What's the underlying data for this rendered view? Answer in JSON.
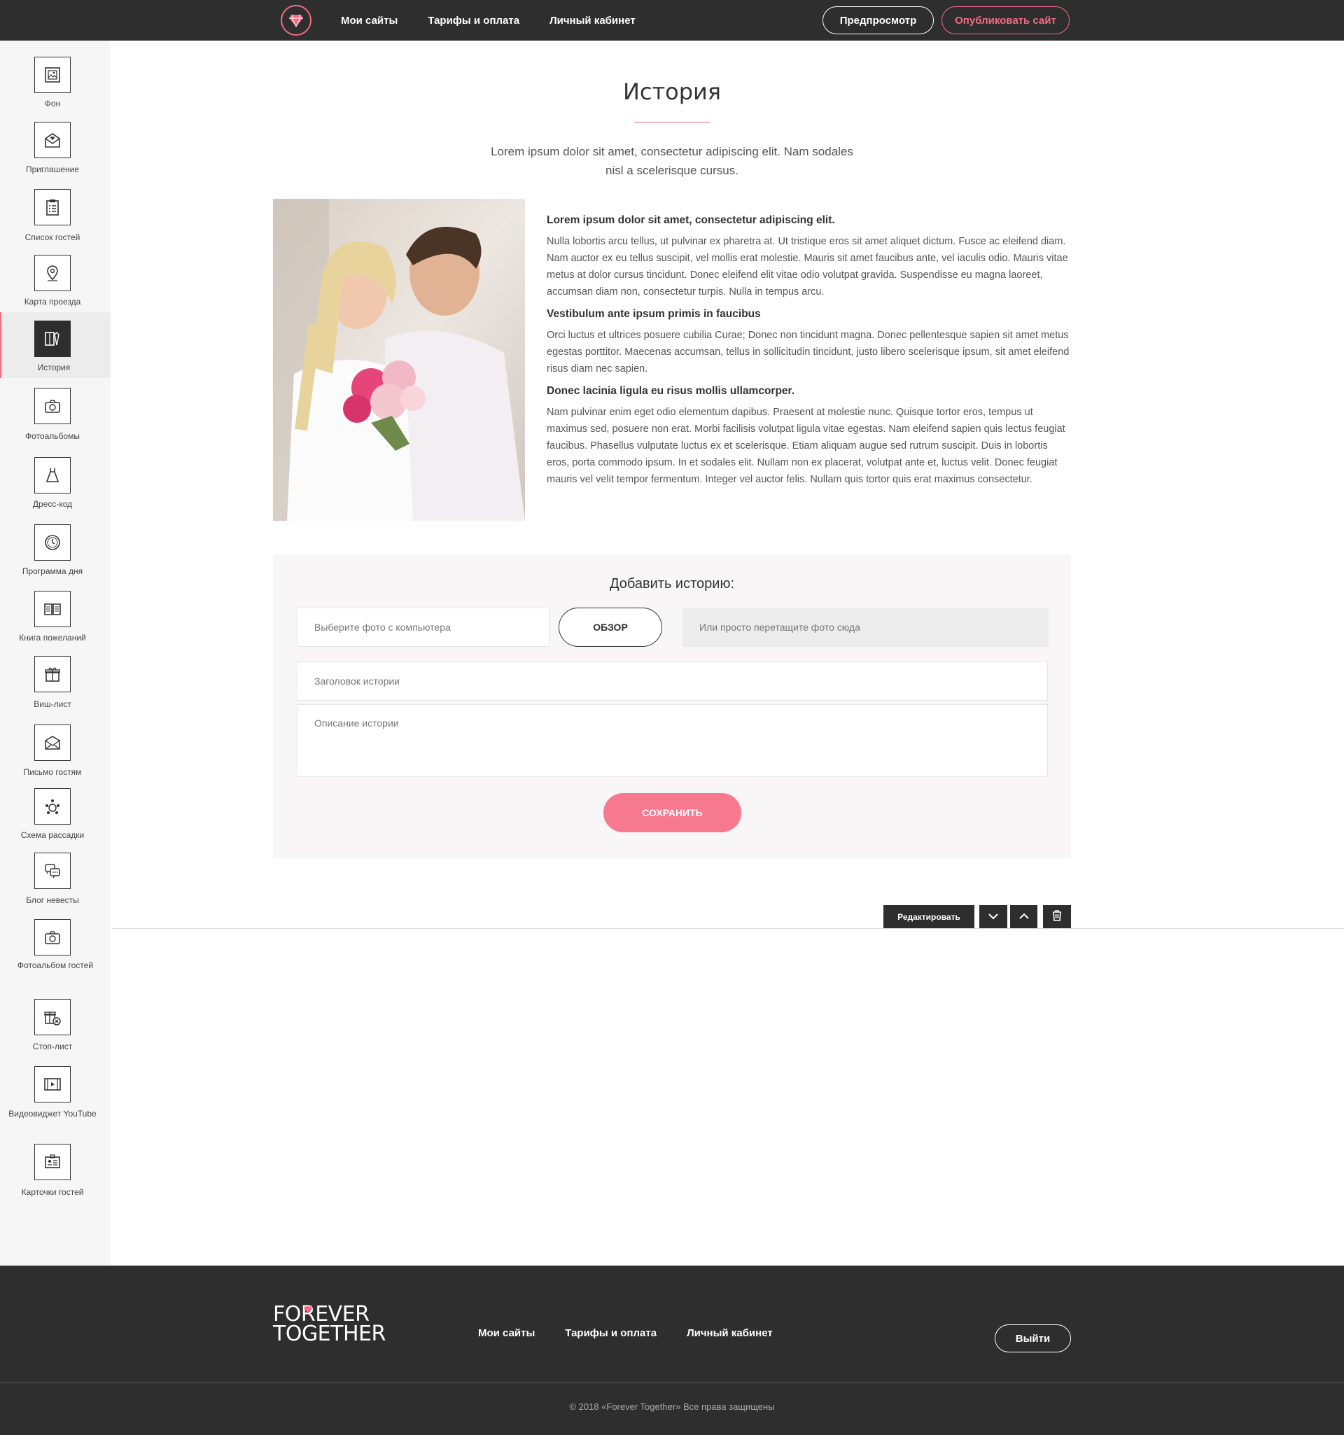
{
  "header": {
    "nav": [
      "Мои сайты",
      "Тарифы и оплата",
      "Личный кабинет"
    ],
    "preview_label": "Предпросмотр",
    "publish_label": "Опубликовать сайт"
  },
  "sidebar": {
    "items": [
      {
        "label": "Фон",
        "icon": "image-icon"
      },
      {
        "label": "Приглашение",
        "icon": "envelope-icon"
      },
      {
        "label": "Список гостей",
        "icon": "clipboard-list-icon"
      },
      {
        "label": "Карта проезда",
        "icon": "map-pin-icon"
      },
      {
        "label": "История",
        "icon": "book-pen-icon"
      },
      {
        "label": "Фотоальбомы",
        "icon": "camera-icon"
      },
      {
        "label": "Дресс-код",
        "icon": "dress-icon"
      },
      {
        "label": "Программа дня",
        "icon": "clock-icon"
      },
      {
        "label": "Книга пожеланий",
        "icon": "open-book-icon"
      },
      {
        "label": "Виш-лист",
        "icon": "gift-icon"
      },
      {
        "label": "Письмо гостям",
        "icon": "letter-icon"
      },
      {
        "label": "Схема рассадки",
        "icon": "seating-icon"
      },
      {
        "label": "Блог невесты",
        "icon": "chat-icon"
      },
      {
        "label": "Фотоальбом гостей",
        "icon": "camera-icon"
      },
      {
        "label": "Стоп-лист",
        "icon": "gift-cross-icon"
      },
      {
        "label": "Видеовиджет YouTube",
        "icon": "video-icon"
      },
      {
        "label": "Карточки гостей",
        "icon": "card-icon"
      }
    ]
  },
  "section": {
    "title": "История",
    "subtitle": "Lorem ipsum dolor sit amet, consectetur adipiscing elit. Nam sodales nisl a scelerisque cursus.",
    "blocks": [
      {
        "heading": "Lorem ipsum dolor sit amet, consectetur adipiscing elit.",
        "text": "Nulla lobortis arcu tellus, ut pulvinar ex pharetra at. Ut tristique eros sit amet aliquet dictum. Fusce ac eleifend diam. Nam auctor ex eu tellus suscipit, vel mollis erat molestie. Mauris sit amet faucibus ante, vel iaculis odio. Mauris vitae metus at dolor cursus tincidunt. Donec eleifend elit vitae odio volutpat gravida. Suspendisse eu magna laoreet, accumsan diam non, consectetur turpis. Nulla in tempus arcu."
      },
      {
        "heading": "Vestibulum ante ipsum primis in faucibus",
        "text": "Orci luctus et ultrices posuere cubilia Curae; Donec non tincidunt magna. Donec pellentesque sapien sit amet metus egestas porttitor. Maecenas accumsan, tellus in sollicitudin tincidunt, justo libero scelerisque ipsum, sit amet eleifend risus diam nec sapien."
      },
      {
        "heading": "Donec lacinia ligula eu risus mollis ullamcorper.",
        "text": "Nam pulvinar enim eget odio elementum dapibus. Praesent at molestie nunc. Quisque tortor eros, tempus ut maximus sed, posuere non erat. Morbi facilisis volutpat ligula vitae egestas. Nam eleifend sapien quis lectus feugiat faucibus. Phasellus vulputate luctus ex et scelerisque. Etiam aliquam augue sed rutrum suscipit. Duis in lobortis eros, porta commodo ipsum. In et sodales elit. Nullam non ex placerat, volutpat ante et, luctus velit. Donec feugiat mauris vel velit tempor fermentum. Integer vel auctor felis. Nullam quis tortor quis erat maximus consectetur."
      }
    ]
  },
  "form": {
    "title": "Добавить историю:",
    "file_placeholder": "Выберите фото с компьютера",
    "browse_label": "ОБЗОР",
    "drop_text": "Или просто перетащите фото сюда",
    "title_placeholder": "Заголовок истории",
    "desc_placeholder": "Описание истории",
    "save_label": "СОХРАНИТЬ"
  },
  "toolbar": {
    "edit_label": "Редактировать"
  },
  "footer": {
    "brand_line1": "FOREVER",
    "brand_line2": "TOGETHER",
    "nav": [
      "Мои сайты",
      "Тарифы и оплата",
      "Личный кабинет"
    ],
    "exit_label": "Выйти",
    "copyright": "© 2018 «Forever Together» Все права защищены"
  },
  "colors": {
    "accent": "#f36b83",
    "dark": "#2e2e2e",
    "save_button": "#f7798f"
  }
}
